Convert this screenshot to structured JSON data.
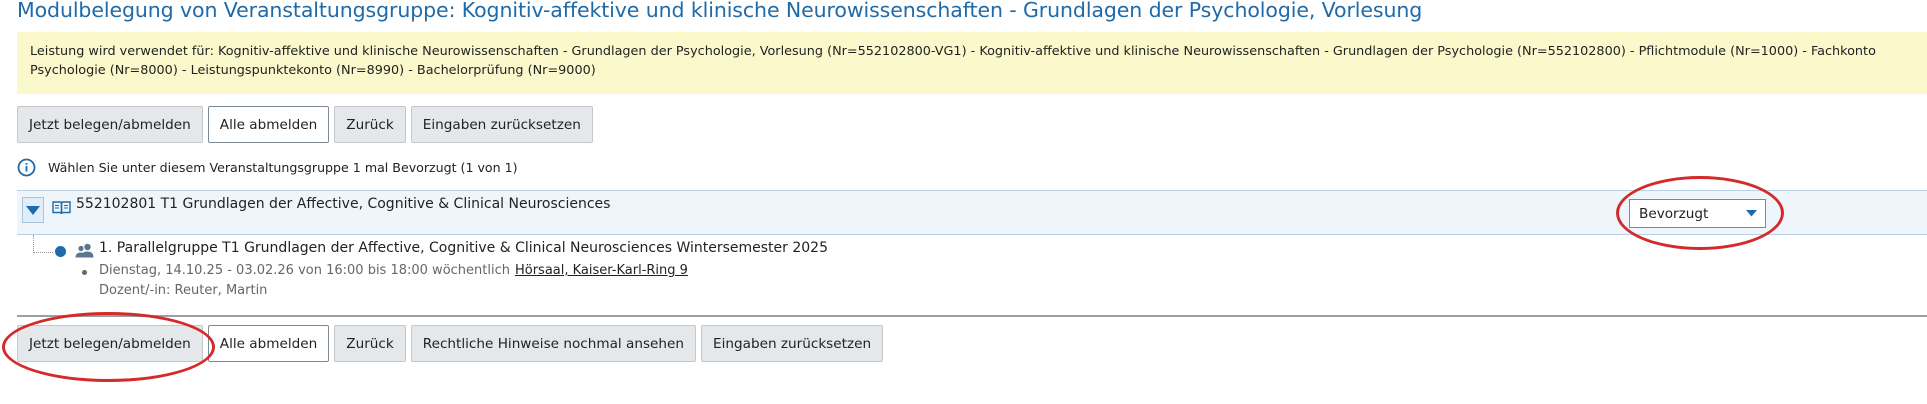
{
  "page_title": "Modulbelegung von Veranstaltungsgruppe: Kognitiv-affektive und klinische Neurowissenschaften - Grundlagen der Psychologie, Vorlesung",
  "info_text": "Leistung wird verwendet für: Kognitiv-affektive und klinische Neurowissenschaften - Grundlagen der Psychologie, Vorlesung (Nr=552102800-VG1) - Kognitiv-affektive und klinische Neurowissenschaften - Grundlagen der Psychologie (Nr=552102800) - Pflichtmodule (Nr=1000) - Fachkonto Psychologie (Nr=8000) - Leistungspunktekonto (Nr=8990) - Bachelorprüfung (Nr=9000)",
  "top_buttons": {
    "enroll": "Jetzt belegen/abmelden",
    "unenroll_all": "Alle abmelden",
    "back": "Zurück",
    "reset": "Eingaben zurücksetzen"
  },
  "hint": {
    "icon": "info-icon",
    "text": "Wählen Sie unter diesem Veranstaltungsgruppe 1 mal Bevorzugt (1 von 1)"
  },
  "course_group": {
    "label": "552102801 T1 Grundlagen der Affective, Cognitive & Clinical Neurosciences",
    "priority_selected": "Bevorzugt",
    "parallel_group": {
      "label": "1. Parallelgruppe T1 Grundlagen der Affective, Cognitive & Clinical Neurosciences Wintersemester 2025",
      "schedule": "Dienstag, 14.10.25 - 03.02.26 von 16:00 bis 18:00 wöchentlich",
      "room": "Hörsaal, Kaiser-Karl-Ring 9",
      "lecturer": "Dozent/-in: Reuter, Martin"
    }
  },
  "bottom_buttons": {
    "enroll": "Jetzt belegen/abmelden",
    "unenroll_all": "Alle abmelden",
    "back": "Zurück",
    "legal": "Rechtliche Hinweise nochmal ansehen",
    "reset": "Eingaben zurücksetzen"
  },
  "colors": {
    "title": "#1f6aa8",
    "info_bg": "#fbf8cc",
    "group_row_bg": "#eef6fc",
    "annotation_red": "#d32a2a"
  }
}
